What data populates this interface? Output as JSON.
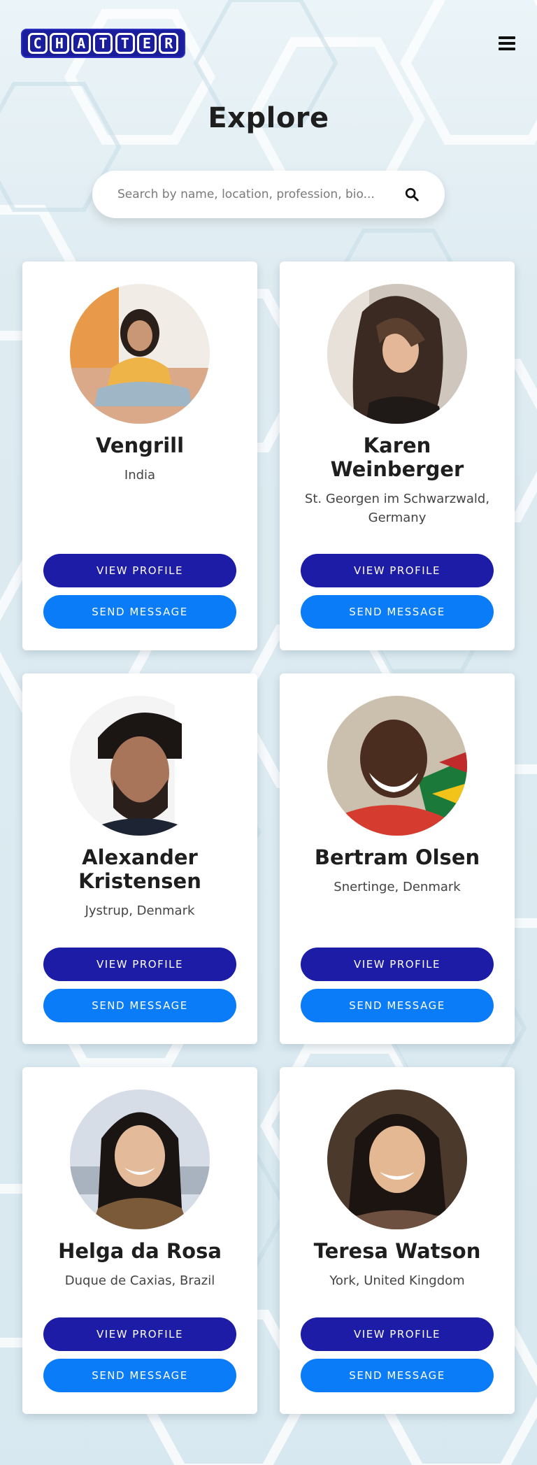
{
  "app": {
    "logo_letters": [
      "C",
      "H",
      "A",
      "T",
      "T",
      "E",
      "R"
    ],
    "brand_color": "#1c1ca6",
    "accent_color": "#0a7cf7",
    "menu_icon": "hamburger-menu-icon"
  },
  "page": {
    "title": "Explore"
  },
  "search": {
    "placeholder": "Search by name, location, profession, bio...",
    "icon": "search-icon"
  },
  "profiles": [
    {
      "name_lines": [
        "Vengrill",
        ""
      ],
      "location_lines": [
        "India",
        ""
      ],
      "view_label": "VIEW PROFILE",
      "send_label": "SEND MESSAGE"
    },
    {
      "name_lines": [
        "Karen",
        "Weinberger"
      ],
      "location_lines": [
        "St. Georgen im Schwarzwald,",
        "Germany"
      ],
      "view_label": "VIEW PROFILE",
      "send_label": "SEND MESSAGE"
    },
    {
      "name_lines": [
        "Alexander",
        "Kristensen"
      ],
      "location_lines": [
        "Jystrup, Denmark",
        ""
      ],
      "view_label": "VIEW PROFILE",
      "send_label": "SEND MESSAGE"
    },
    {
      "name_lines": [
        "Bertram Olsen",
        ""
      ],
      "location_lines": [
        "Snertinge, Denmark",
        ""
      ],
      "view_label": "VIEW PROFILE",
      "send_label": "SEND MESSAGE"
    },
    {
      "name_lines": [
        "Helga da Rosa",
        ""
      ],
      "location_lines": [
        "Duque de Caxias, Brazil",
        ""
      ],
      "view_label": "VIEW PROFILE",
      "send_label": "SEND MESSAGE"
    },
    {
      "name_lines": [
        "Teresa Watson",
        ""
      ],
      "location_lines": [
        "York, United Kingdom",
        ""
      ],
      "view_label": "VIEW PROFILE",
      "send_label": "SEND MESSAGE"
    }
  ]
}
